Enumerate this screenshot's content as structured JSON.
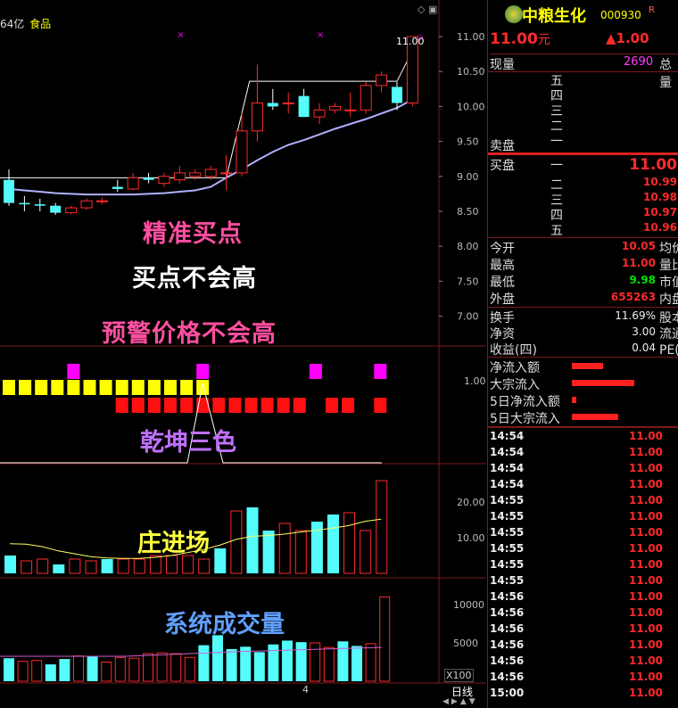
{
  "header": {
    "market_cap": "64亿",
    "sector": "食品",
    "stock_name": "中粮生化",
    "stock_code": "000930",
    "flag": "R",
    "price": "11.00",
    "price_unit": "元",
    "change": "▲1.00",
    "xianliang_label": "现量",
    "xianliang_value": "2690",
    "zongliang_label": "总量"
  },
  "colors": {
    "up": "#ff2a2a",
    "down": "#54fcfc",
    "ma": "#b0b0ff",
    "magenta": "#ff00ff",
    "yellow": "#ffff00",
    "grid": "#7a1a1a"
  },
  "main_chart": {
    "y_ticks": [
      "11.00",
      "10.50",
      "10.00",
      "9.50",
      "9.00",
      "8.50",
      "8.00",
      "7.50",
      "7.00"
    ],
    "last_price_label": "11.00",
    "annotations": [
      "精准买点",
      "买点不会高",
      "预警价格不会高"
    ],
    "candles": [
      {
        "o": 8.95,
        "h": 9.1,
        "l": 8.58,
        "c": 8.62
      },
      {
        "o": 8.62,
        "h": 8.72,
        "l": 8.5,
        "c": 8.6
      },
      {
        "o": 8.6,
        "h": 8.68,
        "l": 8.5,
        "c": 8.58
      },
      {
        "o": 8.58,
        "h": 8.62,
        "l": 8.45,
        "c": 8.48
      },
      {
        "o": 8.48,
        "h": 8.58,
        "l": 8.46,
        "c": 8.55
      },
      {
        "o": 8.55,
        "h": 8.68,
        "l": 8.52,
        "c": 8.65
      },
      {
        "o": 8.65,
        "h": 8.7,
        "l": 8.6,
        "c": 8.65
      },
      {
        "o": 8.85,
        "h": 8.95,
        "l": 8.78,
        "c": 8.82
      },
      {
        "o": 8.82,
        "h": 9.05,
        "l": 8.8,
        "c": 8.98
      },
      {
        "o": 8.98,
        "h": 9.05,
        "l": 8.9,
        "c": 8.95
      },
      {
        "o": 8.9,
        "h": 9.05,
        "l": 8.85,
        "c": 9.0
      },
      {
        "o": 8.95,
        "h": 9.15,
        "l": 8.9,
        "c": 9.05
      },
      {
        "o": 9.0,
        "h": 9.1,
        "l": 8.95,
        "c": 9.05
      },
      {
        "o": 9.0,
        "h": 9.15,
        "l": 8.95,
        "c": 9.1
      },
      {
        "o": 9.05,
        "h": 9.3,
        "l": 8.8,
        "c": 9.05
      },
      {
        "o": 9.05,
        "h": 9.9,
        "l": 9.0,
        "c": 9.65
      },
      {
        "o": 9.65,
        "h": 10.6,
        "l": 9.5,
        "c": 10.05
      },
      {
        "o": 10.05,
        "h": 10.25,
        "l": 9.95,
        "c": 10.0
      },
      {
        "o": 10.05,
        "h": 10.2,
        "l": 9.9,
        "c": 10.05
      },
      {
        "o": 10.15,
        "h": 10.25,
        "l": 9.85,
        "c": 9.85
      },
      {
        "o": 9.85,
        "h": 10.05,
        "l": 9.75,
        "c": 9.95
      },
      {
        "o": 9.95,
        "h": 10.05,
        "l": 9.9,
        "c": 10.0
      },
      {
        "o": 9.95,
        "h": 10.2,
        "l": 9.85,
        "c": 9.95
      },
      {
        "o": 9.95,
        "h": 10.35,
        "l": 9.9,
        "c": 10.3
      },
      {
        "o": 10.3,
        "h": 10.5,
        "l": 10.2,
        "c": 10.45
      },
      {
        "o": 10.28,
        "h": 10.35,
        "l": 9.95,
        "c": 10.05
      },
      {
        "o": 10.05,
        "h": 11.0,
        "l": 10.0,
        "c": 11.0
      }
    ],
    "ma": [
      8.82,
      8.8,
      8.78,
      8.76,
      8.75,
      8.74,
      8.74,
      8.74,
      8.74,
      8.75,
      8.76,
      8.78,
      8.8,
      8.85,
      8.98,
      9.1,
      9.23,
      9.35,
      9.45,
      9.52,
      9.6,
      9.68,
      9.75,
      9.82,
      9.9,
      9.98,
      10.1
    ]
  },
  "qiankun": {
    "label": "乾坤三色",
    "y_tick": "1.00",
    "magenta_at": [
      4,
      12,
      19,
      23
    ],
    "yellow_count": 13,
    "red_from": 7,
    "red_to": 18,
    "red_extra": [
      20,
      21,
      23
    ]
  },
  "zhuang": {
    "label": "庄进场",
    "y_ticks": [
      "20.00",
      "10.00"
    ],
    "values": [
      5,
      3.5,
      4,
      2.5,
      4,
      3.5,
      4,
      4,
      4,
      5,
      5,
      5,
      4,
      7,
      17.5,
      18.5,
      12,
      14,
      12,
      14.5,
      16.5,
      17,
      12,
      26
    ],
    "cyan": [
      0,
      3,
      6,
      13,
      15,
      16,
      19,
      20
    ]
  },
  "volume": {
    "label": "系统成交量",
    "y_ticks": [
      "10000",
      "5000"
    ],
    "unit": "X100",
    "values": [
      3000,
      2600,
      2700,
      2200,
      2900,
      3300,
      3200,
      2500,
      3100,
      3000,
      3600,
      3700,
      3600,
      3100,
      4700,
      6000,
      4200,
      4500,
      3800,
      4800,
      5300,
      5100,
      5000,
      4400,
      5200,
      4600,
      4900,
      11000
    ],
    "cyan": [
      0,
      3,
      4,
      6,
      14,
      15,
      16,
      17,
      18,
      19,
      20,
      21,
      24,
      25
    ]
  },
  "bottom_bar": {
    "date_marker": "4",
    "period_tab": "日线"
  },
  "quote": {
    "ask_label": "卖盘",
    "ask_levels": [
      "五",
      "四",
      "三",
      "二",
      "一"
    ],
    "bid_label": "买盘",
    "bid_levels": [
      {
        "lvl": "一",
        "price": "11.00"
      },
      {
        "lvl": "二",
        "price": "10.99"
      },
      {
        "lvl": "三",
        "price": "10.98"
      },
      {
        "lvl": "四",
        "price": "10.97"
      },
      {
        "lvl": "五",
        "price": "10.96"
      }
    ],
    "stats": [
      {
        "label": "今开",
        "value": "10.05",
        "color": "#ff2a2a",
        "right": "均价"
      },
      {
        "label": "最高",
        "value": "11.00",
        "color": "#ff2a2a",
        "right": "量比"
      },
      {
        "label": "最低",
        "value": "9.98",
        "color": "#00e000",
        "right": "市值"
      },
      {
        "label": "外盘",
        "value": "655263",
        "color": "#ff2a2a",
        "right": "内盘"
      }
    ],
    "stats2": [
      {
        "label": "换手",
        "value": "11.69%",
        "right": "股本"
      },
      {
        "label": "净资",
        "value": "3.00",
        "right": "流通"
      },
      {
        "label": "收益(四)",
        "value": "0.04",
        "right": "PE(动)"
      }
    ],
    "flows": [
      {
        "label": "净流入额",
        "bar": 0.35
      },
      {
        "label": "大宗流入",
        "bar": 0.7
      },
      {
        "label": "5日净流入额",
        "bar": 0.05
      },
      {
        "label": "5日大宗流入",
        "bar": 0.52
      }
    ],
    "ticks": [
      {
        "t": "14:54",
        "p": "11.00"
      },
      {
        "t": "14:54",
        "p": "11.00"
      },
      {
        "t": "14:54",
        "p": "11.00"
      },
      {
        "t": "14:54",
        "p": "11.00"
      },
      {
        "t": "14:55",
        "p": "11.00"
      },
      {
        "t": "14:55",
        "p": "11.00"
      },
      {
        "t": "14:55",
        "p": "11.00"
      },
      {
        "t": "14:55",
        "p": "11.00"
      },
      {
        "t": "14:55",
        "p": "11.00"
      },
      {
        "t": "14:55",
        "p": "11.00"
      },
      {
        "t": "14:56",
        "p": "11.00"
      },
      {
        "t": "14:56",
        "p": "11.00"
      },
      {
        "t": "14:56",
        "p": "11.00"
      },
      {
        "t": "14:56",
        "p": "11.00"
      },
      {
        "t": "14:56",
        "p": "11.00"
      },
      {
        "t": "14:56",
        "p": "11.00"
      },
      {
        "t": "15:00",
        "p": "11.00"
      }
    ]
  }
}
